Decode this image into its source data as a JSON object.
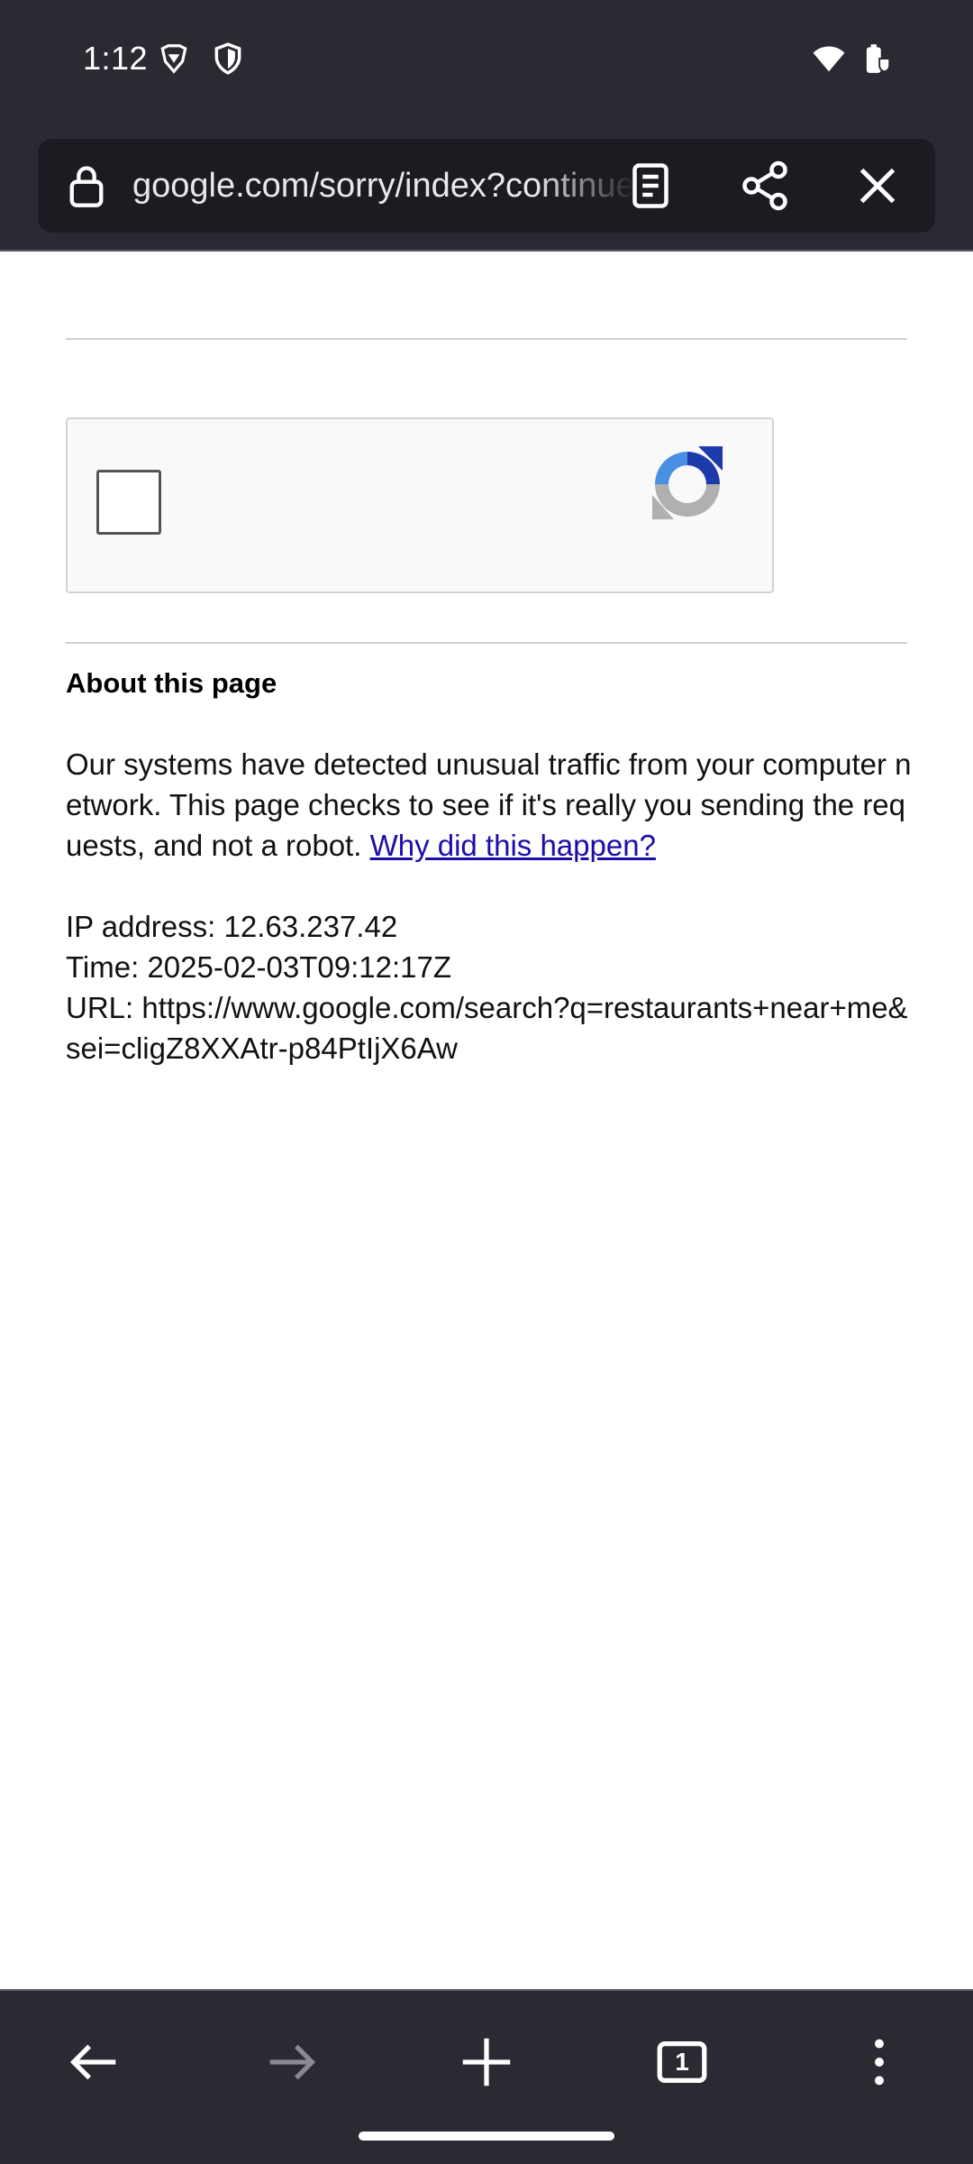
{
  "status_bar": {
    "time": "1:12",
    "icons": [
      "brave-icon",
      "shield-icon",
      "wifi-icon",
      "battery-icon"
    ]
  },
  "toolbar": {
    "url": "google.com/sorry/index?continue=https://www.google.com/search",
    "icons": [
      "lock-icon",
      "reader-mode-icon",
      "share-icon",
      "close-icon"
    ]
  },
  "page": {
    "about_title": "About this page",
    "paragraph": "Our systems have detected unusual traffic from your computer network. This page checks to see if it's really you sending the requests, and not a robot. ",
    "why_link": "Why did this happen?",
    "ip_line": "IP address: 12.63.237.42",
    "time_line": "Time: 2025-02-03T09:12:17Z",
    "url_line": "URL: https://www.google.com/search?q=restaurants+near+me&sei=cligZ8XXAtr-p84PtIjX6Aw"
  },
  "bottom_nav": {
    "tab_count": "1",
    "icons": [
      "back-arrow-icon",
      "forward-arrow-icon",
      "new-tab-plus-icon",
      "tab-switcher-icon",
      "more-menu-icon"
    ]
  },
  "colors": {
    "chrome_bg": "#2b2a33",
    "url_bg": "#1c1b22",
    "link": "#1a0dab"
  }
}
